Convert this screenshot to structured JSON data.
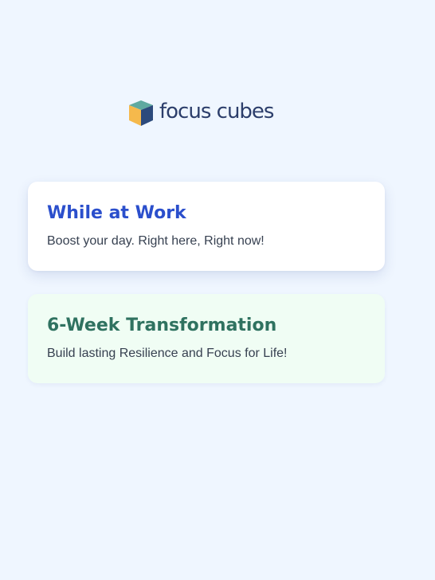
{
  "logo": {
    "text": "focus cubes",
    "icon": "cube-icon",
    "colors": {
      "top": "#5fa9a0",
      "left": "#f5b94c",
      "right": "#2c4a7c",
      "text": "#2c3e6b"
    }
  },
  "cards": [
    {
      "title": "While at Work",
      "description": "Boost your day. Right here, Right now!",
      "title_color": "#2b4fcc",
      "background": "#ffffff"
    },
    {
      "title": "6-Week Transformation",
      "description": "Build lasting Resilience and Focus for Life!",
      "title_color": "#2f7260",
      "background": "#f0fdf4"
    }
  ],
  "page_background": "#eff6ff"
}
